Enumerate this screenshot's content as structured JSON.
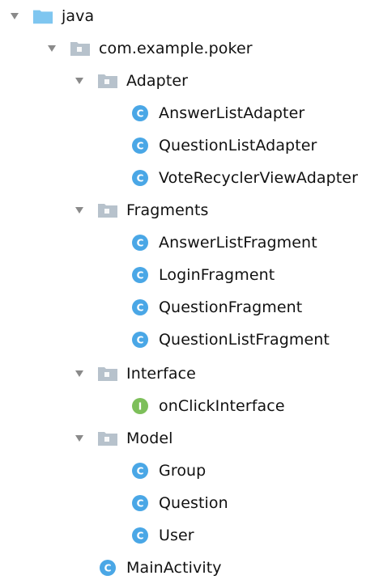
{
  "colors": {
    "folder_blue": "#7FC6F0",
    "package_folder": "#B7C2CC",
    "class_badge": "#4AA7E6",
    "interface_badge": "#7DBF5A",
    "arrow": "#8A8A8A",
    "text": "#111111"
  },
  "tree": {
    "root": {
      "label": "java",
      "icon": "source-folder-icon"
    },
    "package": {
      "label": "com.example.poker",
      "icon": "package-folder-icon"
    },
    "groups": [
      {
        "label": "Adapter",
        "items": [
          {
            "label": "AnswerListAdapter",
            "type": "class",
            "badge": "C"
          },
          {
            "label": "QuestionListAdapter",
            "type": "class",
            "badge": "C"
          },
          {
            "label": "VoteRecyclerViewAdapter",
            "type": "class",
            "badge": "C"
          }
        ]
      },
      {
        "label": "Fragments",
        "items": [
          {
            "label": "AnswerListFragment",
            "type": "class",
            "badge": "C"
          },
          {
            "label": "LoginFragment",
            "type": "class",
            "badge": "C"
          },
          {
            "label": "QuestionFragment",
            "type": "class",
            "badge": "C"
          },
          {
            "label": "QuestionListFragment",
            "type": "class",
            "badge": "C"
          }
        ]
      },
      {
        "label": "Interface",
        "items": [
          {
            "label": "onClickInterface",
            "type": "interface",
            "badge": "I"
          }
        ]
      },
      {
        "label": "Model",
        "items": [
          {
            "label": "Group",
            "type": "class",
            "badge": "C"
          },
          {
            "label": "Question",
            "type": "class",
            "badge": "C"
          },
          {
            "label": "User",
            "type": "class",
            "badge": "C"
          }
        ]
      }
    ],
    "main_activity": {
      "label": "MainActivity",
      "type": "class",
      "badge": "C"
    }
  }
}
